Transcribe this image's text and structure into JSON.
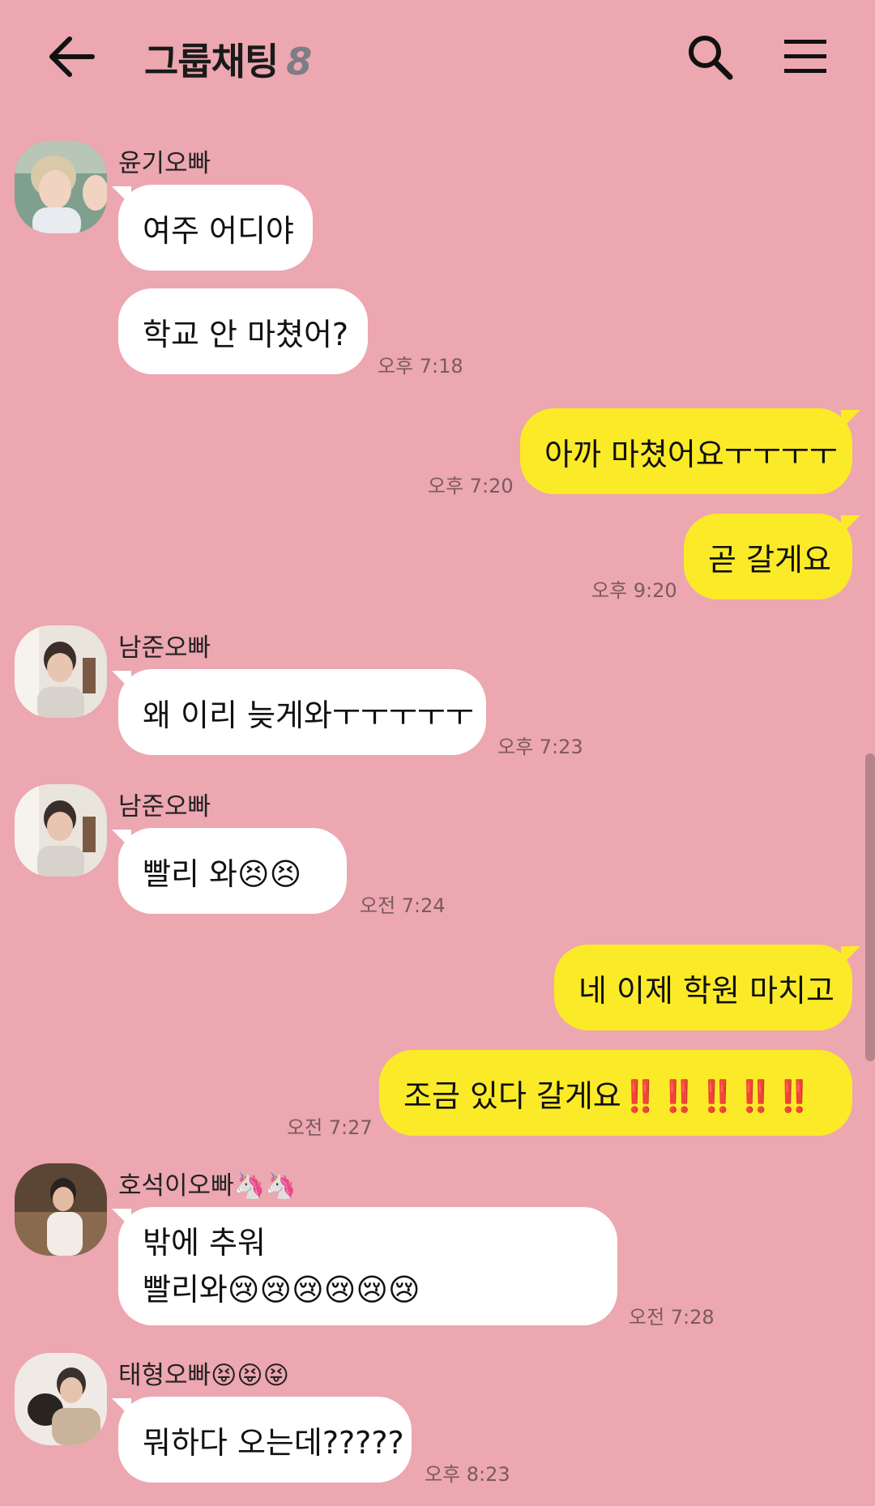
{
  "header": {
    "back_label": "←",
    "title": "그룹채팅",
    "member_count": "8",
    "search_icon": "search-icon",
    "menu_icon": "menu-icon"
  },
  "colors": {
    "background": "#ECA7B0",
    "incoming_bubble": "#FFFFFF",
    "outgoing_bubble": "#FBEA28"
  },
  "messages": [
    {
      "sender": "윤기오빠",
      "text": "여주 어디야",
      "time": ""
    },
    {
      "sender": "",
      "text": "학교 안 마쳤어?",
      "time": "오후 7:18"
    },
    {
      "sender": "me",
      "text": "아까 마쳤어요ㅜㅜㅜㅜ",
      "time": "오후 7:20"
    },
    {
      "sender": "me",
      "text": "곧 갈게요",
      "time": "오후 9:20"
    },
    {
      "sender": "남준오빠",
      "text": "왜 이리 늦게와ㅜㅜㅜㅜㅜ",
      "time": "오후 7:23"
    },
    {
      "sender": "남준오빠",
      "text": "빨리 와😣😣",
      "time": "오전 7:24"
    },
    {
      "sender": "me",
      "text": "네 이제 학원 마치고",
      "time": ""
    },
    {
      "sender": "me",
      "text": "조금 있다 갈게요‼️‼️‼️‼️‼️",
      "time": "오전 7:27"
    },
    {
      "sender": "호석이오빠🦄🦄",
      "text_line1": "밖에 추워",
      "text_line2": "빨리와😢😢😢😢😢😢",
      "time": "오전 7:28"
    },
    {
      "sender": "태형오빠😝😝😝",
      "text": "뭐하다 오는데?????",
      "time": "오후 8:23"
    }
  ]
}
